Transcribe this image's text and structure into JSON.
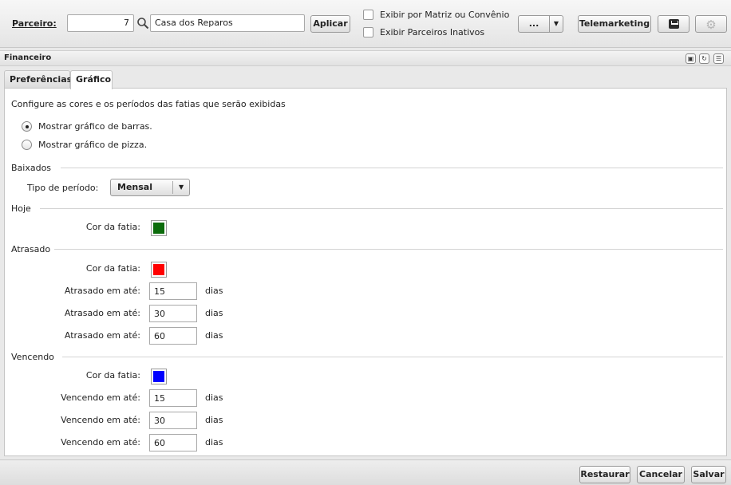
{
  "toolbar": {
    "parceiro_label": "Parceiro:",
    "parceiro_code": "7",
    "parceiro_name": "Casa dos Reparos",
    "aplicar_label": "Aplicar",
    "check_matriz_label": "Exibir por Matriz ou Convênio",
    "check_inativos_label": "Exibir Parceiros Inativos",
    "more_label": "...",
    "dropdown_arrow": "▼",
    "telemarketing_label": "Telemarketing",
    "gear_glyph": "⚙"
  },
  "panel": {
    "title": "Financeiro",
    "header_icons": [
      "windows-icon",
      "refresh-icon",
      "list-icon"
    ],
    "tabs": [
      {
        "label": "Preferências",
        "active": false
      },
      {
        "label": "Gráfico",
        "active": true
      }
    ]
  },
  "grafico": {
    "intro": "Configure as cores e os períodos das fatias que serão exibidas",
    "radio_bar_label": "Mostrar gráfico de barras.",
    "radio_pie_label": "Mostrar gráfico de pizza.",
    "selected_chart": "bar",
    "baixados": {
      "title": "Baixados",
      "period_label": "Tipo de período:",
      "period_value": "Mensal",
      "arrow": "▼"
    },
    "hoje": {
      "title": "Hoje",
      "color_label": "Cor da fatia:",
      "color": "#0b6b0b"
    },
    "atrasado": {
      "title": "Atrasado",
      "color_label": "Cor da fatia:",
      "color": "#ff0000",
      "rows": [
        {
          "label": "Atrasado em até:",
          "value": "15",
          "unit": "dias"
        },
        {
          "label": "Atrasado em até:",
          "value": "30",
          "unit": "dias"
        },
        {
          "label": "Atrasado em até:",
          "value": "60",
          "unit": "dias"
        }
      ]
    },
    "vencendo": {
      "title": "Vencendo",
      "color_label": "Cor da fatia:",
      "color": "#0000ff",
      "rows": [
        {
          "label": "Vencendo em até:",
          "value": "15",
          "unit": "dias"
        },
        {
          "label": "Vencendo em até:",
          "value": "30",
          "unit": "dias"
        },
        {
          "label": "Vencendo em até:",
          "value": "60",
          "unit": "dias"
        }
      ]
    }
  },
  "footer": {
    "restaurar_label": "Restaurar",
    "cancelar_label": "Cancelar",
    "salvar_label": "Salvar"
  }
}
